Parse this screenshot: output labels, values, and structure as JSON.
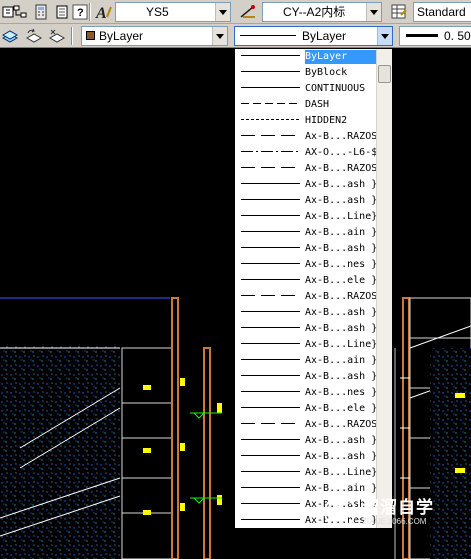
{
  "toolbar1": {
    "text_style_value": "YS5",
    "dim_style_value": "CY--A2内标",
    "table_style_value": "Standard"
  },
  "toolbar2": {
    "color_value": "ByLayer",
    "color_swatch": "#8b5a2b",
    "linetype_value": "ByLayer",
    "lineweight_value": "0. 50"
  },
  "dropdown": {
    "items": [
      {
        "name": "ByLayer",
        "line": "solid",
        "selected": true
      },
      {
        "name": "ByBlock",
        "line": "solid"
      },
      {
        "name": "CONTINUOUS",
        "line": "solid"
      },
      {
        "name": "DASH",
        "line": "dash"
      },
      {
        "name": "HIDDEN2",
        "line": "fine-dash"
      },
      {
        "name": "Ax-B...RAZOS",
        "line": "long-dash"
      },
      {
        "name": "AX-O...-L6-$",
        "line": "dash-dot"
      },
      {
        "name": "Ax-B...RAZOS",
        "line": "long-dash"
      },
      {
        "name": "Ax-B...ash }",
        "line": "solid"
      },
      {
        "name": "Ax-B...ash }",
        "line": "solid"
      },
      {
        "name": "Ax-B...Line}",
        "line": "solid"
      },
      {
        "name": "Ax-B...ain }",
        "line": "solid"
      },
      {
        "name": "Ax-B...ash }",
        "line": "solid"
      },
      {
        "name": "Ax-B...nes }",
        "line": "solid"
      },
      {
        "name": "Ax-B...ele }",
        "line": "solid"
      },
      {
        "name": "Ax-B...RAZOS",
        "line": "long-dash"
      },
      {
        "name": "Ax-B...ash }",
        "line": "solid"
      },
      {
        "name": "Ax-B...ash }",
        "line": "solid"
      },
      {
        "name": "Ax-B...Line}",
        "line": "solid"
      },
      {
        "name": "Ax-B...ain }",
        "line": "solid"
      },
      {
        "name": "Ax-B...ash }",
        "line": "solid"
      },
      {
        "name": "Ax-B...nes }",
        "line": "solid"
      },
      {
        "name": "Ax-B...ele }",
        "line": "solid"
      },
      {
        "name": "Ax-B...RAZOS",
        "line": "long-dash"
      },
      {
        "name": "Ax-B...ash }",
        "line": "solid"
      },
      {
        "name": "Ax-B...ash }",
        "line": "solid"
      },
      {
        "name": "Ax-B...Line}",
        "line": "solid"
      },
      {
        "name": "Ax-B...ain }",
        "line": "solid"
      },
      {
        "name": "Ax-B...ash }",
        "line": "solid"
      },
      {
        "name": "Ax-B...nes }",
        "line": "solid"
      }
    ]
  },
  "watermark": {
    "text": "溜溜自学",
    "url": "ZIXUE.3066.COM"
  }
}
